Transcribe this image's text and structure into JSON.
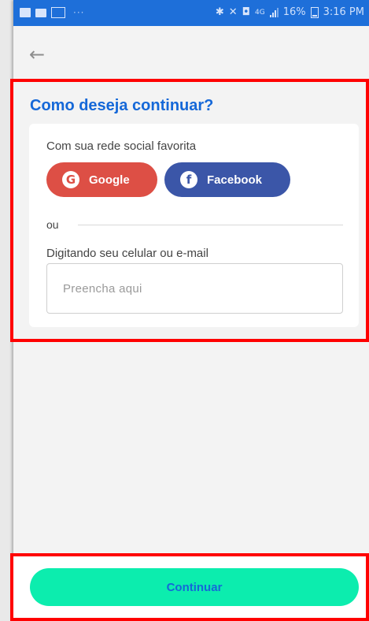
{
  "status_bar": {
    "dots": "···",
    "network": "4G",
    "battery_percent": "16%",
    "time": "3:16 PM"
  },
  "header": {
    "back_icon": "arrow-left-icon"
  },
  "login": {
    "title": "Como deseja continuar?",
    "social_label": "Com sua rede social favorita",
    "google_label": "Google",
    "facebook_label": "Facebook",
    "google_icon": "G",
    "facebook_icon": "f",
    "divider_label": "ou",
    "input_label": "Digitando seu celular ou e-mail",
    "input_placeholder": "Preencha aqui",
    "input_value": ""
  },
  "footer": {
    "continue_label": "Continuar"
  },
  "colors": {
    "status_bar": "#1e6fd9",
    "title": "#1568d8",
    "google": "#dd4f45",
    "facebook": "#3b56a8",
    "continue_bg": "#0cedae",
    "annotation": "#ff0000"
  }
}
